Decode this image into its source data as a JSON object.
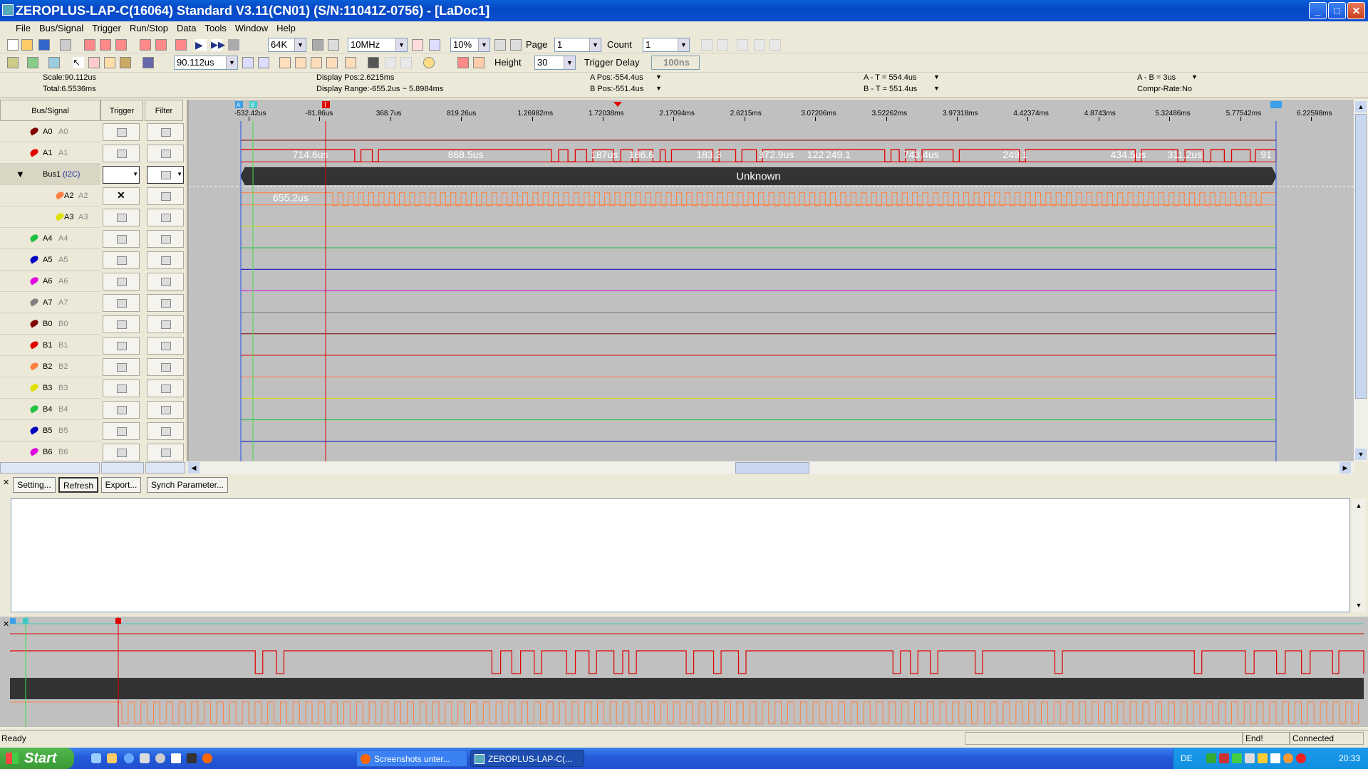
{
  "window": {
    "title": "ZEROPLUS-LAP-C(16064) Standard V3.11(CN01) (S/N:11041Z-0756) - [LaDoc1]",
    "minimize": "_",
    "maximize": "□",
    "close": "✕"
  },
  "menu": [
    "File",
    "Bus/Signal",
    "Trigger",
    "Run/Stop",
    "Data",
    "Tools",
    "Window",
    "Help"
  ],
  "toolbar1": {
    "memory": "64K",
    "samplerate": "10MHz",
    "trigger_pos": "10%",
    "page_label": "Page",
    "page": "1",
    "count_label": "Count",
    "count": "1"
  },
  "toolbar2": {
    "scale": "90.112us",
    "height_label": "Height",
    "height": "30",
    "trigger_delay_label": "Trigger Delay",
    "trigger_delay": "100ns"
  },
  "info": {
    "scale": "Scale:90.112us",
    "total": "Total:6.5536ms",
    "display_pos": "Display Pos:2.6215ms",
    "display_range": "Display Range:-655.2us ~ 5.8984ms",
    "a_pos": "A Pos:-554.4us",
    "b_pos": "B Pos:-551.4us",
    "a_t": "A - T = 554.4us",
    "b_t": "B - T = 551.4us",
    "a_b": "A - B = 3us",
    "compr": "Compr-Rate:No"
  },
  "columns": {
    "bus_signal": "Bus/Signal",
    "trigger": "Trigger",
    "filter": "Filter"
  },
  "signals": [
    {
      "name": "A0",
      "alias": "A0",
      "color": "#800000"
    },
    {
      "name": "A1",
      "alias": "A1",
      "color": "#e00000"
    },
    {
      "name": "Bus1",
      "alias": "(I2C)",
      "color": "#000000"
    },
    {
      "name": "A2",
      "alias": "A2",
      "color": "#ff8040"
    },
    {
      "name": "A3",
      "alias": "A3",
      "color": "#e0e000"
    },
    {
      "name": "A4",
      "alias": "A4",
      "color": "#20c040"
    },
    {
      "name": "A5",
      "alias": "A5",
      "color": "#0000c0"
    },
    {
      "name": "A6",
      "alias": "A6",
      "color": "#e000e0"
    },
    {
      "name": "A7",
      "alias": "A7",
      "color": "#808080"
    },
    {
      "name": "B0",
      "alias": "B0",
      "color": "#800000"
    },
    {
      "name": "B1",
      "alias": "B1",
      "color": "#e00000"
    },
    {
      "name": "B2",
      "alias": "B2",
      "color": "#ff8040"
    },
    {
      "name": "B3",
      "alias": "B3",
      "color": "#e0e000"
    },
    {
      "name": "B4",
      "alias": "B4",
      "color": "#20c040"
    },
    {
      "name": "B5",
      "alias": "B5",
      "color": "#0000c0"
    },
    {
      "name": "B6",
      "alias": "B6",
      "color": "#e000e0"
    }
  ],
  "ruler_ticks": [
    "-532.42us",
    "-81.86us",
    "368.7us",
    "819.26us",
    "1.26982ms",
    "1.72038ms",
    "2.17094ms",
    "2.6215ms",
    "3.07206ms",
    "3.52262ms",
    "3.97318ms",
    "4.42374ms",
    "4.8743ms",
    "5.32486ms",
    "5.77542ms",
    "6.22598ms"
  ],
  "cursor_labels": {
    "a": "A",
    "b": "B",
    "t": "T"
  },
  "wave_labels": {
    "a1": [
      "714.6us",
      "868.5us",
      "187us",
      "186.6",
      "183.3",
      "372.9us",
      "122",
      "249.1",
      "743.4us",
      "249.1",
      "434.5us",
      "311.2us",
      "91"
    ],
    "bus": "Unknown",
    "a2": "655.2us"
  },
  "buttons": {
    "setting": "Setting...",
    "refresh": "Refresh",
    "export": "Export...",
    "synch": "Synch Parameter..."
  },
  "status": {
    "ready": "Ready",
    "end": "End!",
    "connected": "Connected"
  },
  "taskbar": {
    "start": "Start",
    "task1": "Screenshots unter...",
    "task2": "ZEROPLUS-LAP-C(...",
    "lang": "DE",
    "clock": "20:33"
  }
}
